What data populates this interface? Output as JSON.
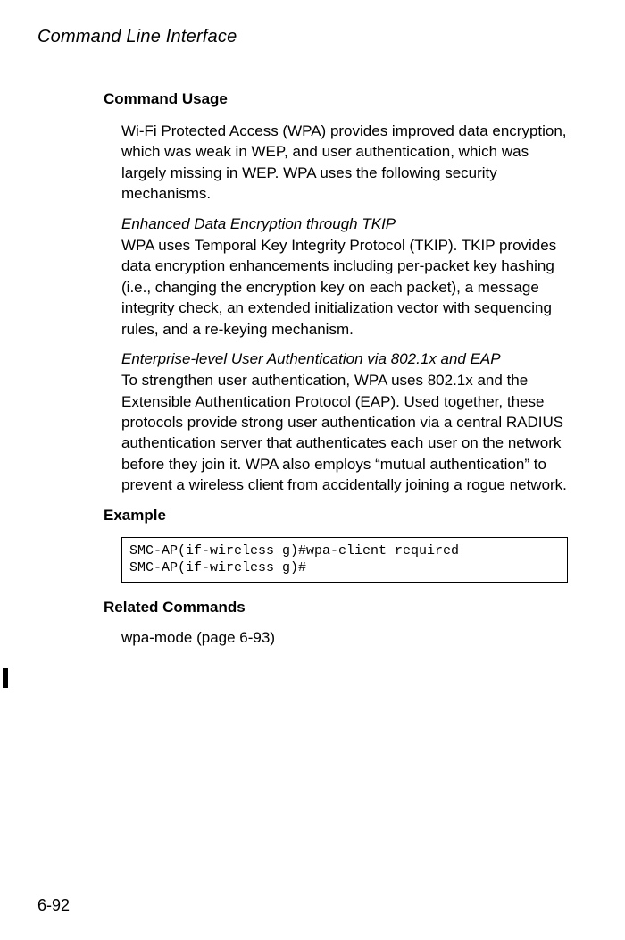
{
  "header": {
    "title": "Command Line Interface"
  },
  "sections": {
    "command_usage": {
      "heading": "Command Usage",
      "intro": "Wi-Fi Protected Access (WPA) provides improved data encryption, which was weak in WEP, and user authentication, which was largely missing in WEP. WPA uses the following security mechanisms.",
      "tkip_heading": "Enhanced Data Encryption through TKIP",
      "tkip_body": "WPA uses Temporal Key Integrity Protocol (TKIP). TKIP provides data encryption enhancements including per-packet key hashing (i.e., changing the encryption key on each packet), a message integrity check, an extended initialization vector with sequencing rules, and a re-keying mechanism.",
      "eap_heading": "Enterprise-level User Authentication via 802.1x and EAP",
      "eap_body": "To strengthen user authentication, WPA uses 802.1x and the Extensible Authentication Protocol (EAP). Used together, these protocols provide strong user authentication via a central RADIUS authentication server that authenticates each user on the network before they join it. WPA also employs “mutual authentication” to prevent a wireless client from accidentally joining a rogue network."
    },
    "example": {
      "heading": "Example",
      "code": "SMC-AP(if-wireless g)#wpa-client required\nSMC-AP(if-wireless g)#"
    },
    "related": {
      "heading": "Related Commands",
      "text": "wpa-mode (page 6-93)"
    }
  },
  "page_number": "6-92"
}
